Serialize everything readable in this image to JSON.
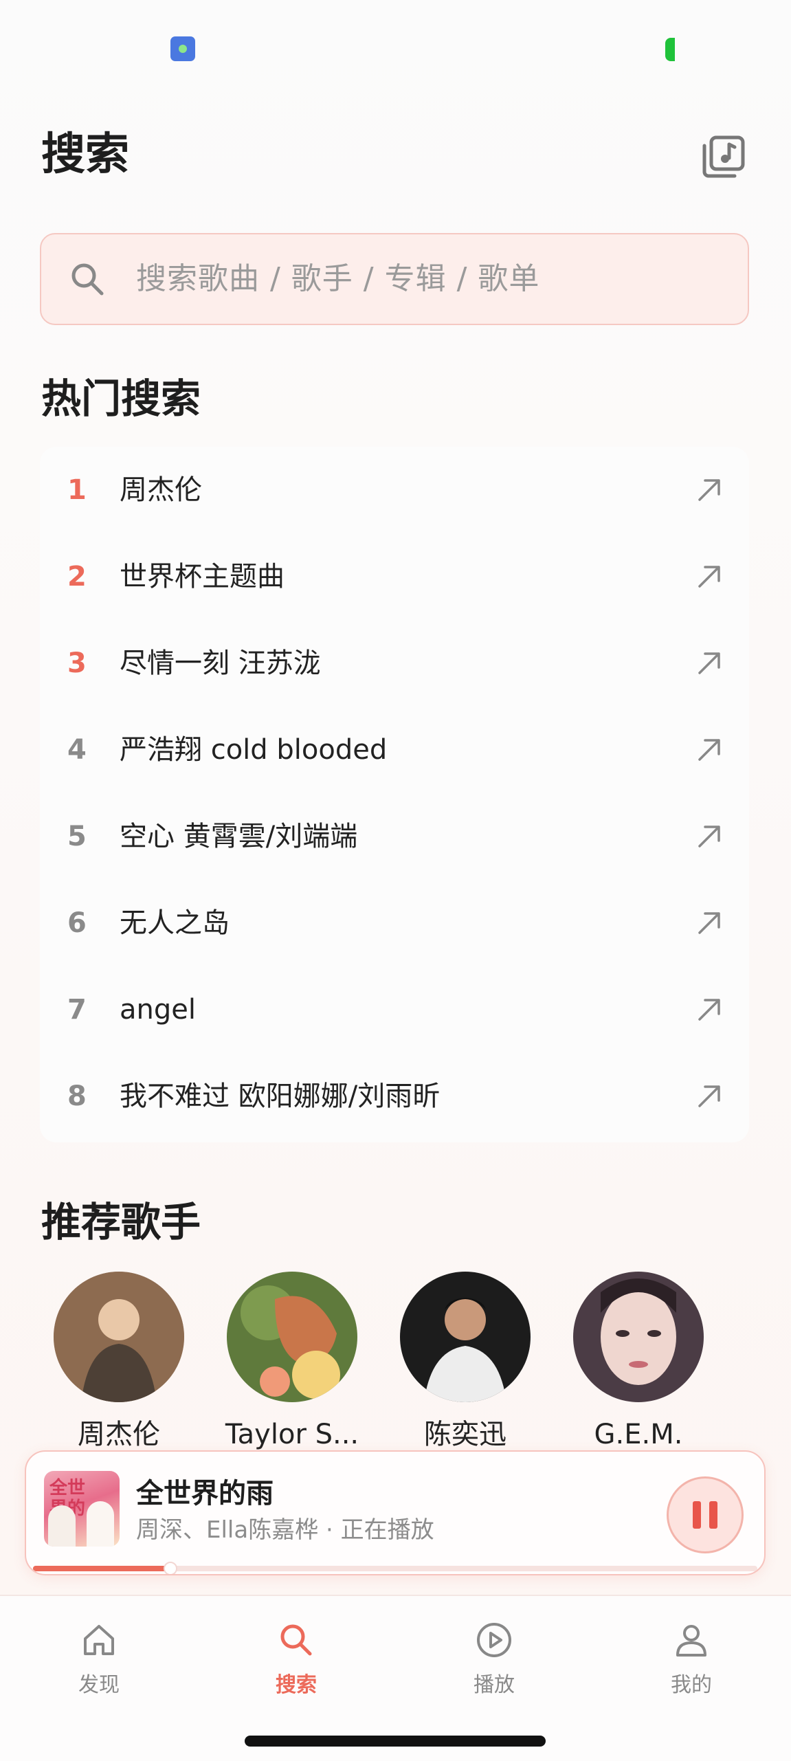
{
  "header": {
    "title": "搜索"
  },
  "search": {
    "placeholder": "搜索歌曲 / 歌手 / 专辑 / 歌单"
  },
  "hot_search": {
    "title": "热门搜索",
    "items": [
      {
        "rank": "1",
        "text": "周杰伦"
      },
      {
        "rank": "2",
        "text": "世界杯主题曲"
      },
      {
        "rank": "3",
        "text": "尽情一刻 汪苏泷"
      },
      {
        "rank": "4",
        "text": "严浩翔 cold blooded"
      },
      {
        "rank": "5",
        "text": "空心 黄霄雲/刘端端"
      },
      {
        "rank": "6",
        "text": "无人之岛"
      },
      {
        "rank": "7",
        "text": "angel"
      },
      {
        "rank": "8",
        "text": "我不难过 欧阳娜娜/刘雨昕"
      }
    ]
  },
  "singers": {
    "title": "推荐歌手",
    "items": [
      {
        "name": "周杰伦"
      },
      {
        "name": "Taylor S..."
      },
      {
        "name": "陈奕迅"
      },
      {
        "name": "G.E.M."
      }
    ]
  },
  "player": {
    "title": "全世界的雨",
    "subtitle": "周深、Ella陈嘉桦 · 正在播放",
    "cover_text": "全世界的雨",
    "progress": 0.19
  },
  "tabs": [
    {
      "label": "发现",
      "icon": "home-icon"
    },
    {
      "label": "搜索",
      "icon": "search-icon"
    },
    {
      "label": "播放",
      "icon": "play-circle-icon"
    },
    {
      "label": "我的",
      "icon": "user-icon"
    }
  ],
  "colors": {
    "accent": "#ec6a5a",
    "search_bg": "#fdeeeb",
    "rank_gray": "#8a8a8a"
  }
}
